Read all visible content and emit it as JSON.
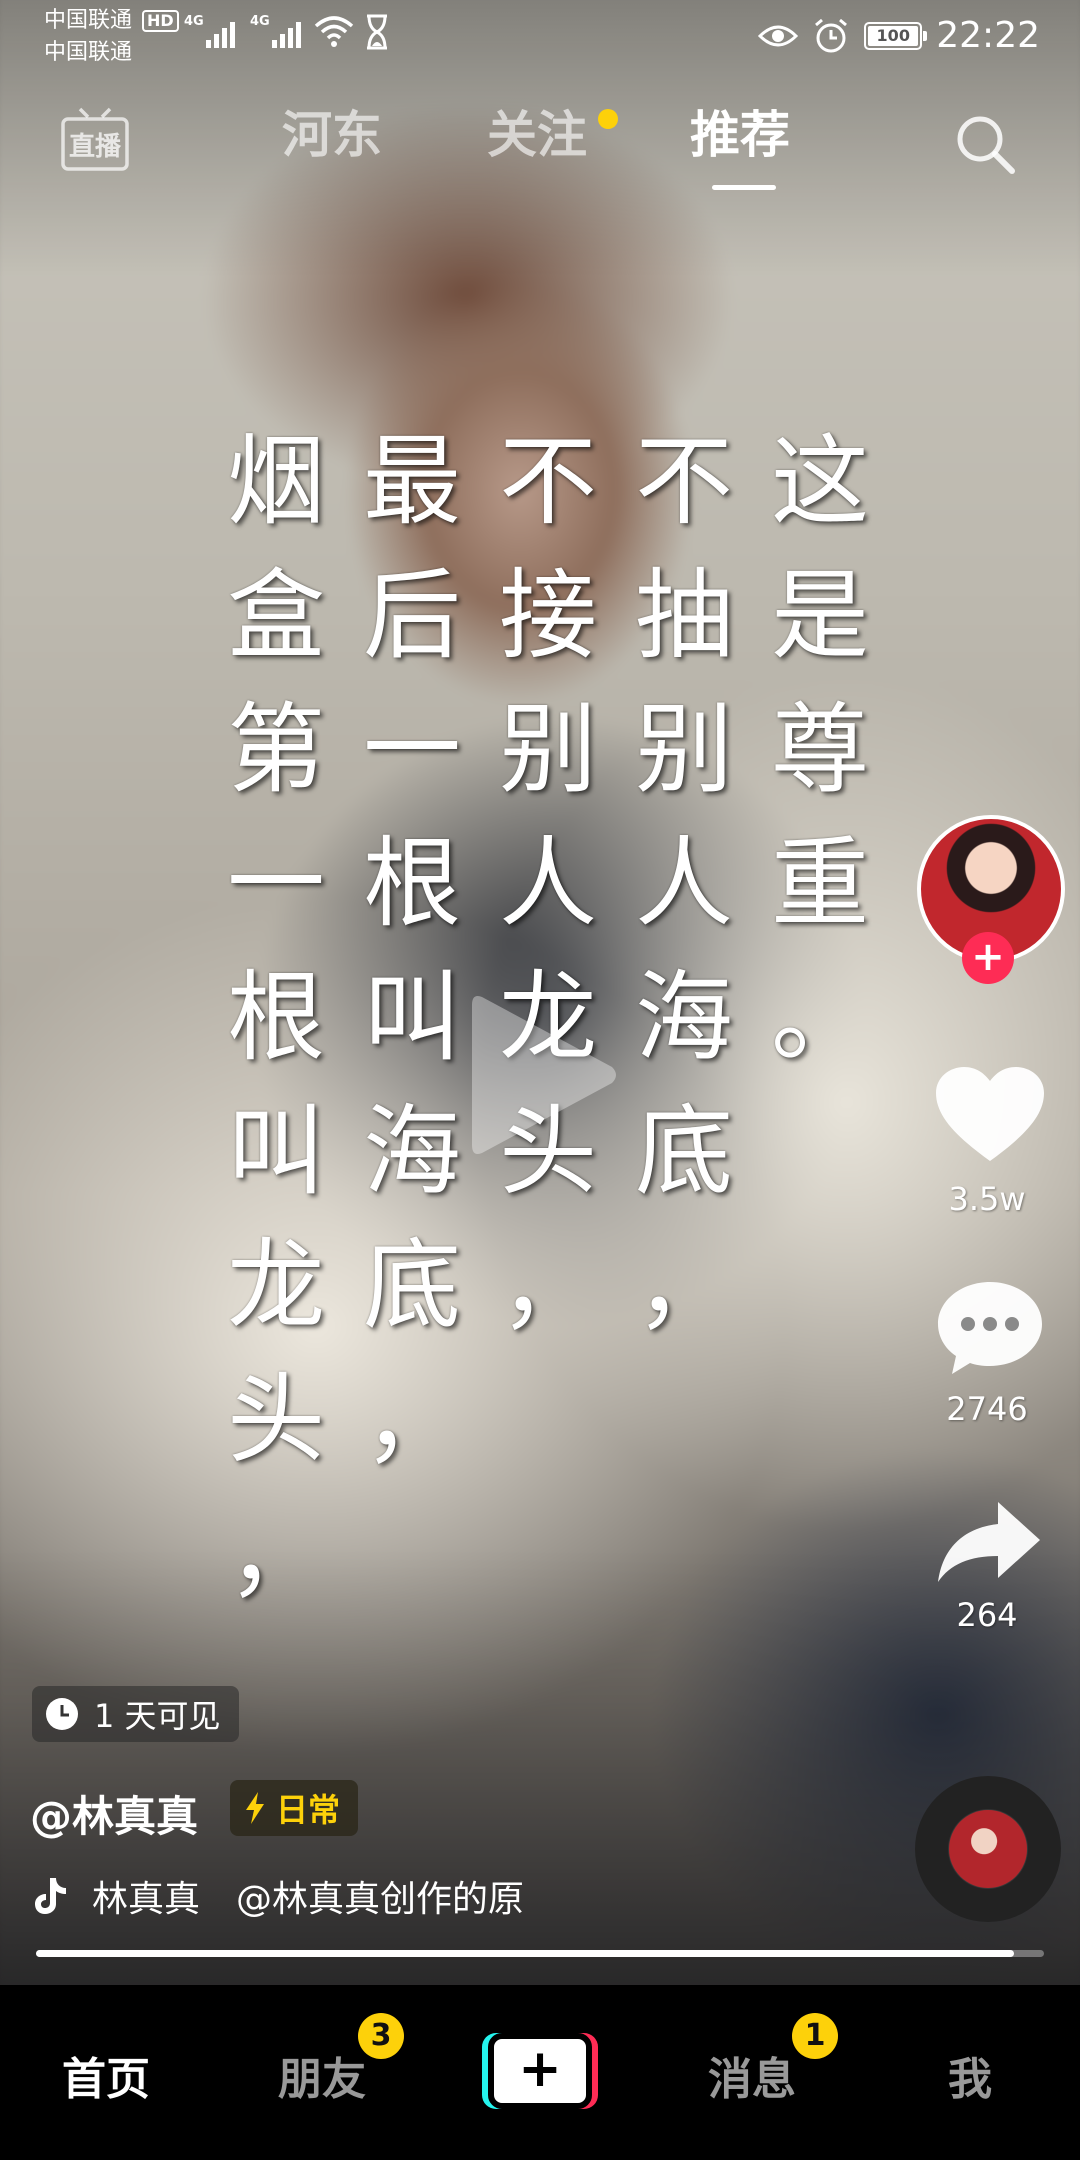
{
  "status_bar": {
    "carrier_1": "中国联通",
    "carrier_2": "中国联通",
    "hd": "HD",
    "network_1": "4G",
    "network_2": "4G",
    "battery": "100",
    "time": "22:22"
  },
  "top_nav": {
    "live_label": "直播",
    "tabs": [
      "河东",
      "关注",
      "推荐"
    ],
    "active_tab": "推荐"
  },
  "caption_columns": [
    [
      "这",
      "是",
      "尊",
      "重",
      "。"
    ],
    [
      "不",
      "抽",
      "别",
      "人",
      "海",
      "底",
      "，"
    ],
    [
      "不",
      "接",
      "别",
      "人",
      "龙",
      "头",
      "，"
    ],
    [
      "最",
      "后",
      "一",
      "根",
      "叫",
      "海",
      "底",
      "，"
    ],
    [
      "烟",
      "盒",
      "第",
      "一",
      "根",
      "叫",
      "龙",
      "头",
      "，"
    ]
  ],
  "sidebar": {
    "like_count": "3.5w",
    "comment_count": "2746",
    "share_count": "264"
  },
  "info": {
    "visibility": "1 天可见",
    "author": "@林真真",
    "tag": "日常",
    "music_text": "林真真　@林真真创作的原"
  },
  "progress": {
    "fraction": 0.97
  },
  "tab_bar": {
    "home": "首页",
    "friends": "朋友",
    "friends_badge": "3",
    "create": "+",
    "messages": "消息",
    "messages_badge": "1",
    "me": "我"
  },
  "colors": {
    "accent_red": "#fe2c55",
    "accent_cyan": "#25f4ee",
    "badge_yellow": "#fdd10a"
  }
}
